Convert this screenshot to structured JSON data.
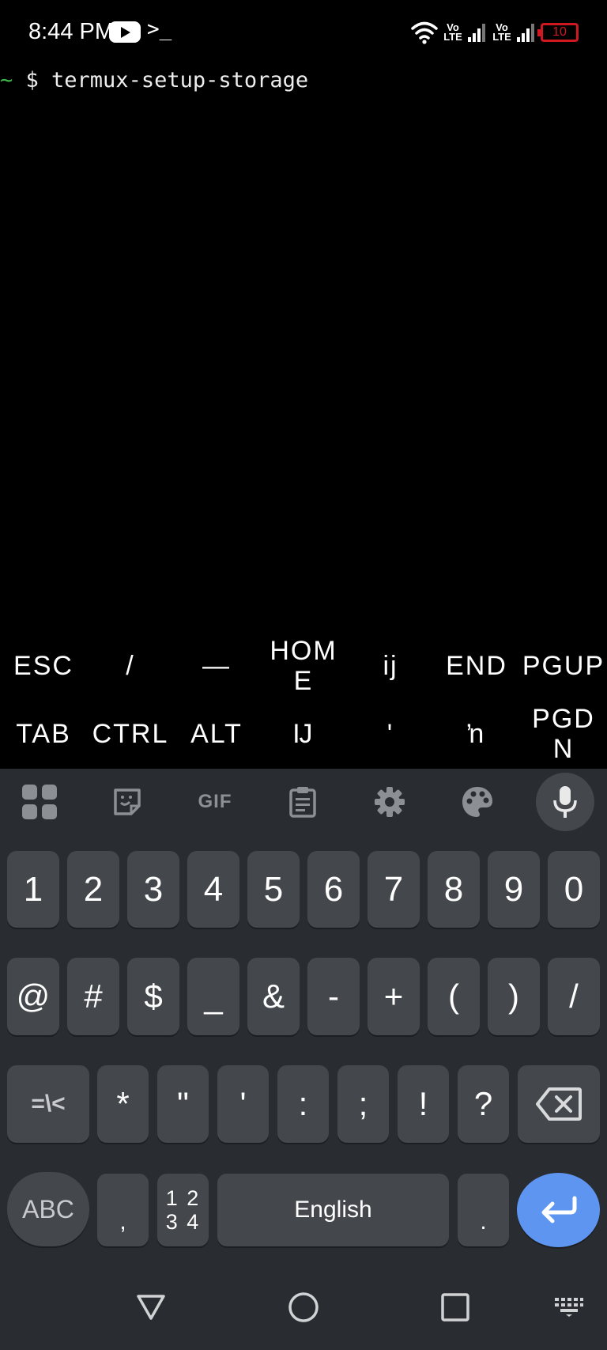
{
  "status_bar": {
    "time": "8:44 PM",
    "lte1": "Vo\nLTE",
    "lte2": "Vo\nLTE",
    "battery": "10"
  },
  "terminal": {
    "prompt_tilde": "~",
    "command_line": " $ termux-setup-storage"
  },
  "extra_keys": {
    "row1": [
      "ESC",
      "/",
      "—",
      "HOM\nE",
      "ij",
      "END",
      "PGUP"
    ],
    "row2": [
      "TAB",
      "CTRL",
      "ALT",
      "Ĳ",
      "ʹ",
      "ŉ",
      "PGD\nN"
    ]
  },
  "keyboard": {
    "toolbar_icons": [
      "apps-grid-icon",
      "sticker-icon",
      "gif-icon",
      "clipboard-icon",
      "gear-icon",
      "palette-icon",
      "microphone-icon"
    ],
    "gif_label": "GIF",
    "row_numbers": [
      "1",
      "2",
      "3",
      "4",
      "5",
      "6",
      "7",
      "8",
      "9",
      "0"
    ],
    "row_symbols1": [
      "@",
      "#",
      "$",
      "_",
      "&",
      "-",
      "+",
      "(",
      ")",
      "/"
    ],
    "row_symbols2": [
      "*",
      "\"",
      "'",
      ":",
      ";",
      "!",
      "?"
    ],
    "more_symbols_label": "=\\<",
    "abc_label": "ABC",
    "comma_label": ",",
    "numpad_label": "1 2\n3 4",
    "space_label": "English",
    "period_label": "."
  },
  "colors": {
    "keyboard_bg": "#292c30",
    "key_bg": "#44474b",
    "enter_accent": "#5d95f1",
    "battery_low": "#d01820",
    "prompt_green": "#3bb84a"
  }
}
